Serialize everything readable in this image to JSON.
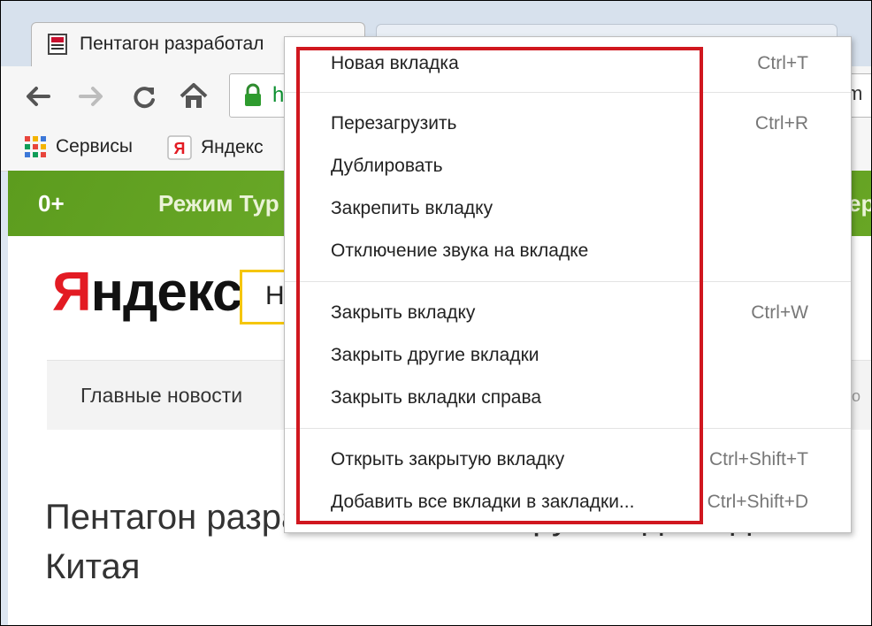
{
  "browser": {
    "active_tab_title": "Пентагон разработал",
    "omnibox_text": "h",
    "omnibox_trailing_text": "m"
  },
  "bookmarks": [
    {
      "label": "Сервисы",
      "icon": "apps-grid-icon"
    },
    {
      "label": "Яндекс",
      "icon": "yandex-favicon-icon"
    }
  ],
  "greenbar": {
    "age_label": "0+",
    "turbo_label": "Режим Тур",
    "right_fragment": "ер"
  },
  "page": {
    "logo": "Яндекс",
    "logo_first_letter": "Я",
    "logo_rest": "ндекс",
    "search_text": "Н",
    "news_link": "Главные новости",
    "news_right_fragment": "о",
    "headline_line1": "Пентагон разработал новое оружие для сде",
    "headline_line2": "Китая"
  },
  "context_menu": {
    "groups": [
      [
        {
          "label": "Новая вкладка",
          "shortcut": "Ctrl+T"
        }
      ],
      [
        {
          "label": "Перезагрузить",
          "shortcut": "Ctrl+R"
        },
        {
          "label": "Дублировать",
          "shortcut": ""
        },
        {
          "label": "Закрепить вкладку",
          "shortcut": ""
        },
        {
          "label": "Отключение звука на вкладке",
          "shortcut": ""
        }
      ],
      [
        {
          "label": "Закрыть вкладку",
          "shortcut": "Ctrl+W"
        },
        {
          "label": "Закрыть другие вкладки",
          "shortcut": ""
        },
        {
          "label": "Закрыть вкладки справа",
          "shortcut": ""
        }
      ],
      [
        {
          "label": "Открыть закрытую вкладку",
          "shortcut": "Ctrl+Shift+T"
        },
        {
          "label": "Добавить все вкладки в закладки...",
          "shortcut": "Ctrl+Shift+D"
        }
      ]
    ]
  },
  "colors": {
    "highlight": "#d0171f",
    "green_bar": "#62a322",
    "yandex_red": "#e31b23",
    "search_border": "#f5c60c"
  }
}
